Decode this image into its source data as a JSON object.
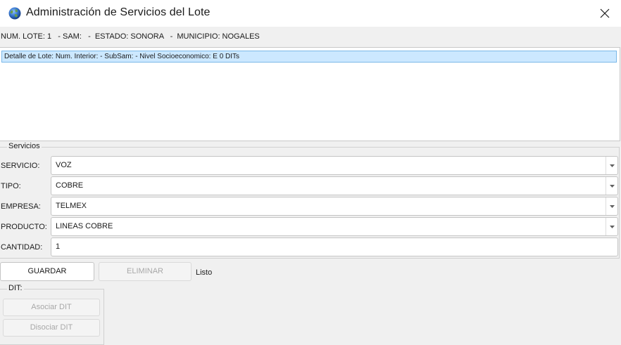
{
  "window": {
    "title": "Administración de Servicios del Lote",
    "icon": "globe-icon",
    "close_icon": "close-icon"
  },
  "info_bar": {
    "text": "NUM. LOTE: 1   - SAM:   -  ESTADO: SONORA   -  MUNICIPIO: NOGALES"
  },
  "list": {
    "items": [
      {
        "label": "Detalle de Lote: Num. Interior:  - SubSam:  - Nivel Socioeconomico: E 0 DITs",
        "selected": true
      }
    ]
  },
  "servicios": {
    "legend": "Servicios",
    "servicio": {
      "label": "SERVICIO:",
      "value": "VOZ"
    },
    "tipo": {
      "label": "TIPO:",
      "value": "COBRE"
    },
    "empresa": {
      "label": "EMPRESA:",
      "value": "TELMEX"
    },
    "producto": {
      "label": "PRODUCTO:",
      "value": "LINEAS COBRE"
    },
    "cantidad": {
      "label": "CANTIDAD:",
      "value": "1"
    }
  },
  "actions": {
    "guardar": "GUARDAR",
    "eliminar": "ELIMINAR",
    "status": "Listo"
  },
  "dit": {
    "legend": "DIT:",
    "asociar": "Asociar DIT",
    "disociar": "Disociar DIT"
  },
  "colors": {
    "selection_bg": "#cce8ff",
    "selection_border": "#7ab8e8",
    "window_bg": "#f0f0f0"
  }
}
